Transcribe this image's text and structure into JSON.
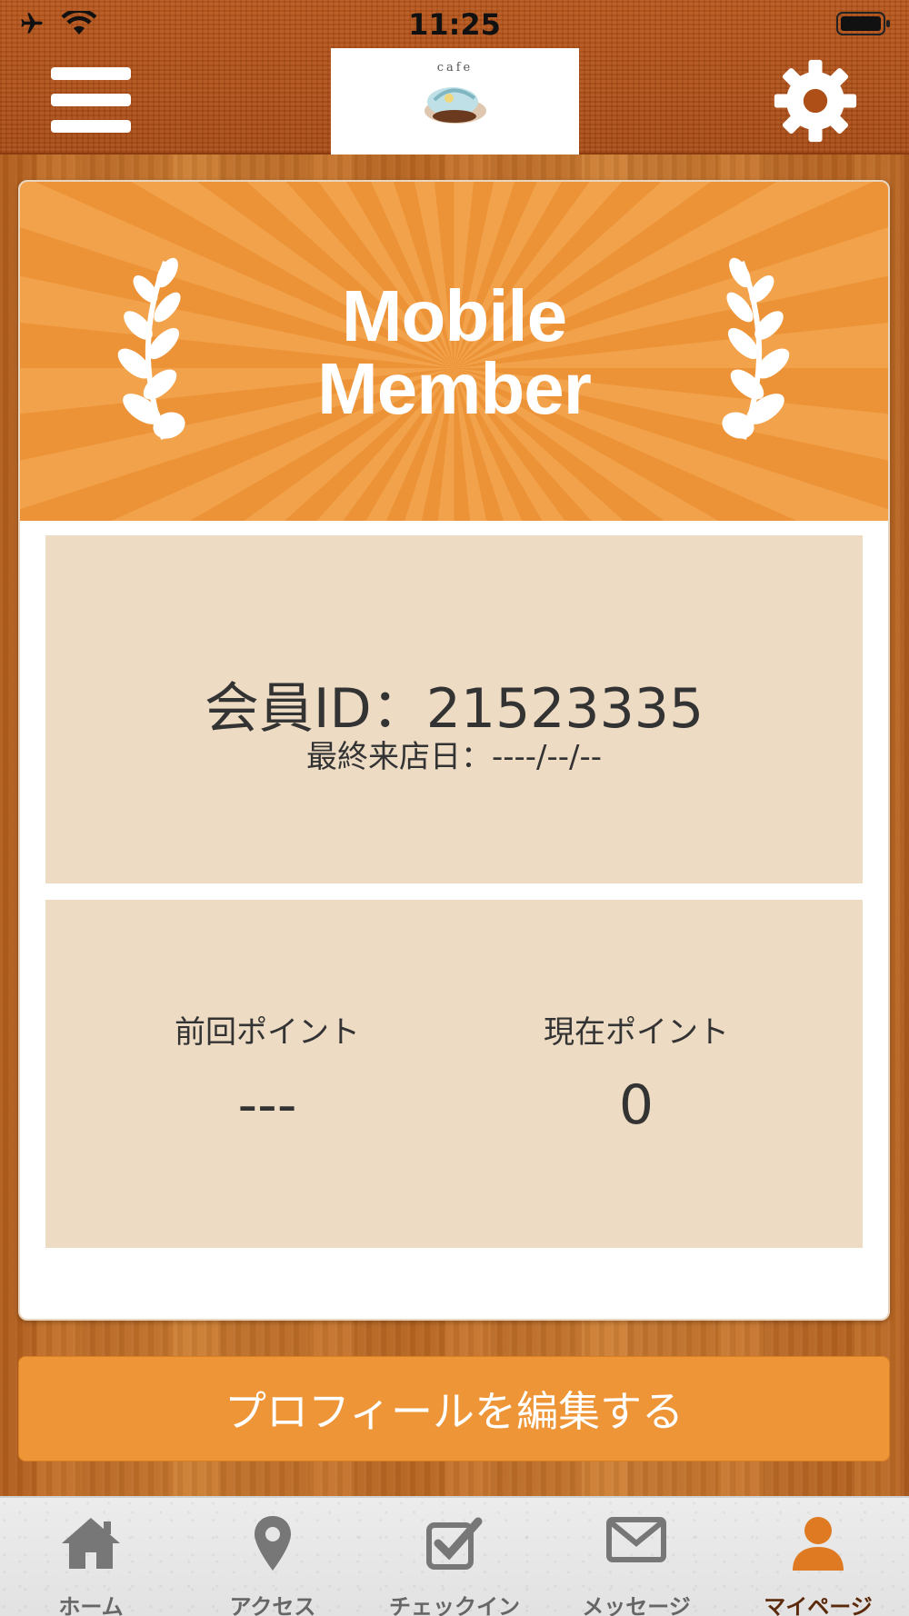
{
  "status_bar": {
    "time": "11:25"
  },
  "header": {
    "logo_text": "cafe"
  },
  "banner": {
    "title_line1": "Mobile",
    "title_line2": "Member"
  },
  "member": {
    "id_text": "会員ID：21523335",
    "last_visit_text": "最終来店日：----/--/--"
  },
  "points": {
    "previous_label": "前回ポイント",
    "previous_value": "---",
    "current_label": "現在ポイント",
    "current_value": "0"
  },
  "edit_button_label": "プロフィールを編集する",
  "tabs": [
    {
      "label": "ホーム",
      "icon": "home-icon"
    },
    {
      "label": "アクセス",
      "icon": "map-pin-icon"
    },
    {
      "label": "チェックイン",
      "icon": "checkbox-icon"
    },
    {
      "label": "メッセージ",
      "icon": "envelope-icon"
    },
    {
      "label": "マイページ",
      "icon": "user-icon",
      "active": true
    }
  ],
  "colors": {
    "accent": "#ee9537",
    "banner_light": "#f2a24a",
    "panel": "#eddbc4",
    "active_tab": "#e07a22",
    "inactive_tab": "#777777"
  }
}
